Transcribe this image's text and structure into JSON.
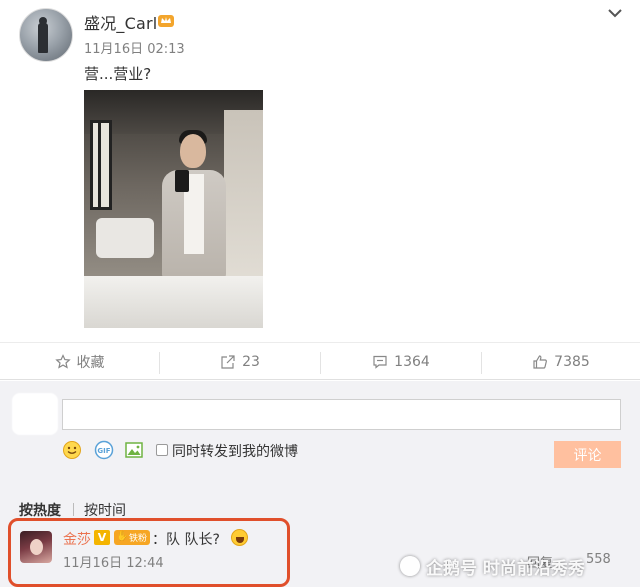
{
  "post": {
    "username": "盛况_Carl",
    "time": "11月16日 02:13",
    "text": "营...营业?"
  },
  "actions": [
    {
      "icon": "star-icon",
      "label": "收藏"
    },
    {
      "icon": "share-icon",
      "label": "23"
    },
    {
      "icon": "comment-icon",
      "label": "1364"
    },
    {
      "icon": "thumbs-up-icon",
      "label": "7385"
    }
  ],
  "composer": {
    "input_value": "",
    "tools": [
      "smiley-icon",
      "gif-icon",
      "image-icon"
    ],
    "repost_label": "同时转发到我的微博",
    "repost_checked": false,
    "submit_label": "评论"
  },
  "sort_tabs": {
    "hot": "按热度",
    "time": "按时间"
  },
  "comment": {
    "name": "金莎",
    "verified_badge": "V",
    "fan_badge": "铁粉",
    "text": "：队 队长?",
    "time": "11月16日 12:44",
    "reply_label": "回复",
    "like_count": "558"
  },
  "watermark": {
    "text": "企鹅号 时尚前沿秀秀"
  },
  "colors": {
    "accent_orange": "#eb7350",
    "submit_bg": "#ffc09f",
    "highlight_border": "#e04f2b",
    "comment_bg": "#f2f2f5"
  }
}
